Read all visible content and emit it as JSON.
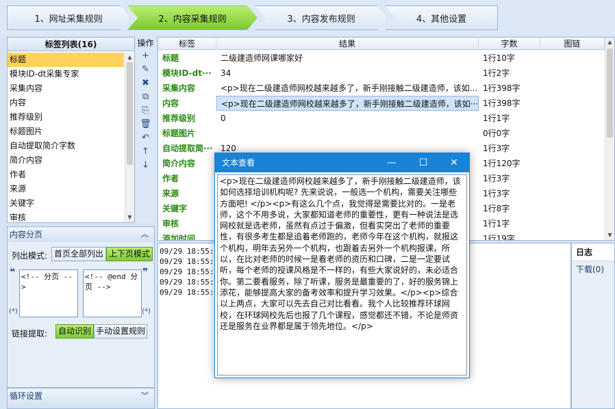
{
  "steps": [
    {
      "label": "1、网址采集规则"
    },
    {
      "label": "2、内容采集规则"
    },
    {
      "label": "3、内容发布规则"
    },
    {
      "label": "4、其他设置"
    }
  ],
  "tag_panel": {
    "title": "标签列表(16)",
    "items": [
      "标题",
      "模块ID-dt采集专家",
      "采集内容",
      "内容",
      "推荐级别",
      "标题图片",
      "自动提取简介字数",
      "简介内容",
      "作者",
      "来源",
      "关键字",
      "审核"
    ]
  },
  "ops": {
    "title": "操作",
    "buttons": [
      "+",
      "✎",
      "✖",
      "⧉",
      "⎘",
      "🗑",
      "↶",
      "↑",
      "↓"
    ]
  },
  "grid": {
    "headers": [
      "标签",
      "结果",
      "字数",
      "图链"
    ],
    "rows": [
      {
        "label": "标题",
        "result": "二级建造师网课哪家好",
        "count": "1行10字"
      },
      {
        "label": "模块ID-dt···",
        "result": "34",
        "count": "1行2字"
      },
      {
        "label": "采集内容",
        "result": "<p>现在二级建造师网校越来越多了，新手刚接触二级建造师，该如...",
        "count": "1行398字"
      },
      {
        "label": "内容",
        "result": "<p>现在二级建造师网校越来越多了，新手刚接触二级建造师，该如···",
        "count": "1行398字"
      },
      {
        "label": "推荐级别",
        "result": "0",
        "count": "1行1字"
      },
      {
        "label": "标题图片",
        "result": "",
        "count": "0行0字"
      },
      {
        "label": "自动提取简···",
        "result": "120",
        "count": "1行3字"
      },
      {
        "label": "简介内容",
        "result": "",
        "count": "1行120字"
      },
      {
        "label": "作者",
        "result": "",
        "count": "1行3字"
      },
      {
        "label": "来源",
        "result": "",
        "count": "1行3字"
      },
      {
        "label": "关键字",
        "result": "",
        "count": "1行8字"
      },
      {
        "label": "审核",
        "result": "",
        "count": "1行1字"
      },
      {
        "label": "添加时间",
        "result": "",
        "count": "1行19字"
      }
    ]
  },
  "pagination": {
    "title": "内容分页",
    "list_mode_label": "列出模式:",
    "mode_all": "首页全部列出",
    "mode_prev_next": "上下页模式",
    "start_marker": "<!-- 分页 -->",
    "end_marker": "<!-- @end 分页 -->",
    "link_extract_label": "链接提取:",
    "auto_detect": "自动识别",
    "manual_rule": "手动设置规则"
  },
  "loop_panel": {
    "title": "循环设置"
  },
  "log": {
    "lines": [
      "09/29 18:55:21",
      "09/29 18:55:21",
      "09/29 18:55:21",
      "09/29 18:55:21",
      "09/29 18:55:21"
    ]
  },
  "diary": {
    "title": "日志",
    "item": "下载(0)"
  },
  "modal": {
    "title": "文本查看",
    "content": "<p>现在二级建造师网校越来越多了，新手刚接触二级建造师，该如何选择培训机构呢? 先来说说，一般选一个机构，需要关注哪些方面吧! </p><p>有这么几个点，我觉得是需要比对的。一是老师，这个不用多说，大家都知道老师的重要性，更有一种说法是选网校就是选老师，虽然有点过于偏激，但看实突出了老师的重要性，有很多考生都是追着老师跑的，老师今年在这个机构，就报这个机构，明年去另外一个机构，也跟着去另外一个机构报课。所以，在比对老师的时候一是看老师的资历和口碑，二是一定要试听，每个老师的授课风格是不一样的，有些大家说好的，未必适合你。第二要看服务，除了听课，服务是最重要的了，好的服务锦上添花，能够提高大家的备考效率和提升学习效果。</p><p>综合以上两点，大家可以先去自己对比看看。我个人比较推荐环球网校，在环球网校先后也报了几个课程，感觉都还不错，不论是师资还是服务在业界都是属于领先地位。</p>"
  }
}
